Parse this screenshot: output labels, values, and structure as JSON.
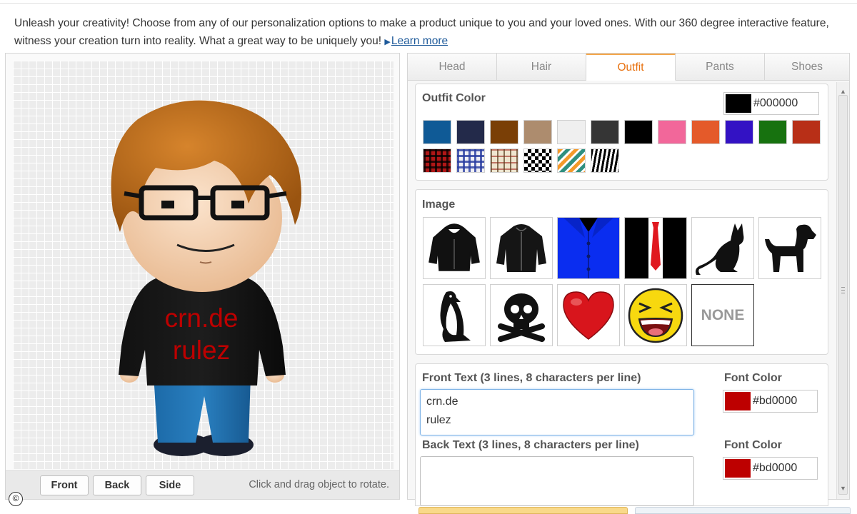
{
  "intro": {
    "text": "Unleash your creativity! Choose from any of our personalization options to make a product unique to you and your loved ones. With our 360 degree interactive feature, witness your creation turn into reality. What a great way to be uniquely you!",
    "learn_more": "Learn more"
  },
  "preview": {
    "shirt_text_line1": "crn.de",
    "shirt_text_line2": "rulez",
    "buttons": {
      "front": "Front",
      "back": "Back",
      "side": "Side"
    },
    "hint": "Click and drag object to rotate.",
    "copyright": "©"
  },
  "tabs": [
    {
      "label": "Head",
      "active": false
    },
    {
      "label": "Hair",
      "active": false
    },
    {
      "label": "Outfit",
      "active": true
    },
    {
      "label": "Pants",
      "active": false
    },
    {
      "label": "Shoes",
      "active": false
    }
  ],
  "outfit_color": {
    "title": "Outfit Color",
    "selected_hex": "#000000",
    "solid_swatches": [
      "#0f5a96",
      "#232a4a",
      "#7a3f06",
      "#ad8c6e",
      "#efefef",
      "#353535",
      "#000000",
      "#f2679a",
      "#e45a2a",
      "#3312c4",
      "#17720f",
      "#b82f17"
    ],
    "pattern_swatches": [
      "red-plaid",
      "blue-plaid",
      "beige-plaid",
      "houndstooth",
      "diagonal-stripes",
      "zebra"
    ]
  },
  "image": {
    "title": "Image",
    "items": [
      "hoodie-icon",
      "jacket-icon",
      "blue-shirt-icon",
      "tuxedo-tie-icon",
      "cat-icon",
      "dog-icon",
      "penguin-icon",
      "skull-crossbones-icon",
      "heart-icon",
      "laughing-smiley-icon",
      "none-option"
    ],
    "none_label": "NONE"
  },
  "front_text": {
    "label": "Front Text (3 lines, 8 characters per line)",
    "value": "crn.de\nrulez",
    "font_color_label": "Font Color",
    "font_color_hex": "#bd0000"
  },
  "back_text": {
    "label": "Back Text (3 lines, 8 characters per line)",
    "value": "",
    "font_color_label": "Font Color",
    "font_color_hex": "#bd0000"
  },
  "colors": {
    "accent": "#e8710f",
    "font_red": "#bd0000",
    "link": "#1e5a9a"
  }
}
